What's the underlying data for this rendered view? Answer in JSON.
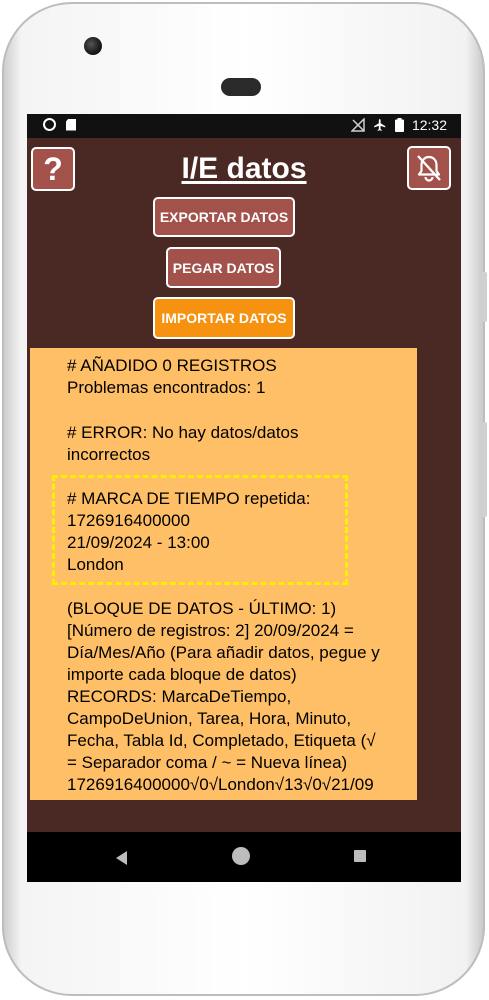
{
  "status_bar": {
    "time": "12:32"
  },
  "header": {
    "title": "I/E datos",
    "help_label": "?"
  },
  "buttons": {
    "export": "EXPORTAR DATOS",
    "paste": "PEGAR DATOS",
    "import": "IMPORTAR DATOS"
  },
  "panel": {
    "lines": [
      "# AÑADIDO 0 REGISTROS",
      "Problemas encontrados: 1",
      "# ERROR: No hay datos/datos",
      "incorrectos",
      "# MARCA DE TIEMPO repetida:",
      "1726916400000",
      "21/09/2024 - 13:00",
      "London",
      "(BLOQUE DE DATOS - ÚLTIMO: 1)",
      "[Número de registros: 2] 20/09/2024 =",
      "Día/Mes/Año (Para añadir datos, pegue y",
      "importe cada bloque de datos)",
      "RECORDS: MarcaDeTiempo,",
      "CampoDeUnion, Tarea, Hora, Minuto,",
      "Fecha, Tabla Id, Completado, Etiqueta (√",
      "= Separador coma / ~ = Nueva línea)",
      "1726916400000√0√London√13√0√21/09"
    ]
  },
  "icons": {
    "help": "question-mark-icon",
    "bell": "bell-off-icon"
  },
  "colors": {
    "background": "#4a2925",
    "button": "#a3524b",
    "import_button": "#f6920f",
    "panel": "#ffbf66",
    "highlight": "#ffee00"
  }
}
